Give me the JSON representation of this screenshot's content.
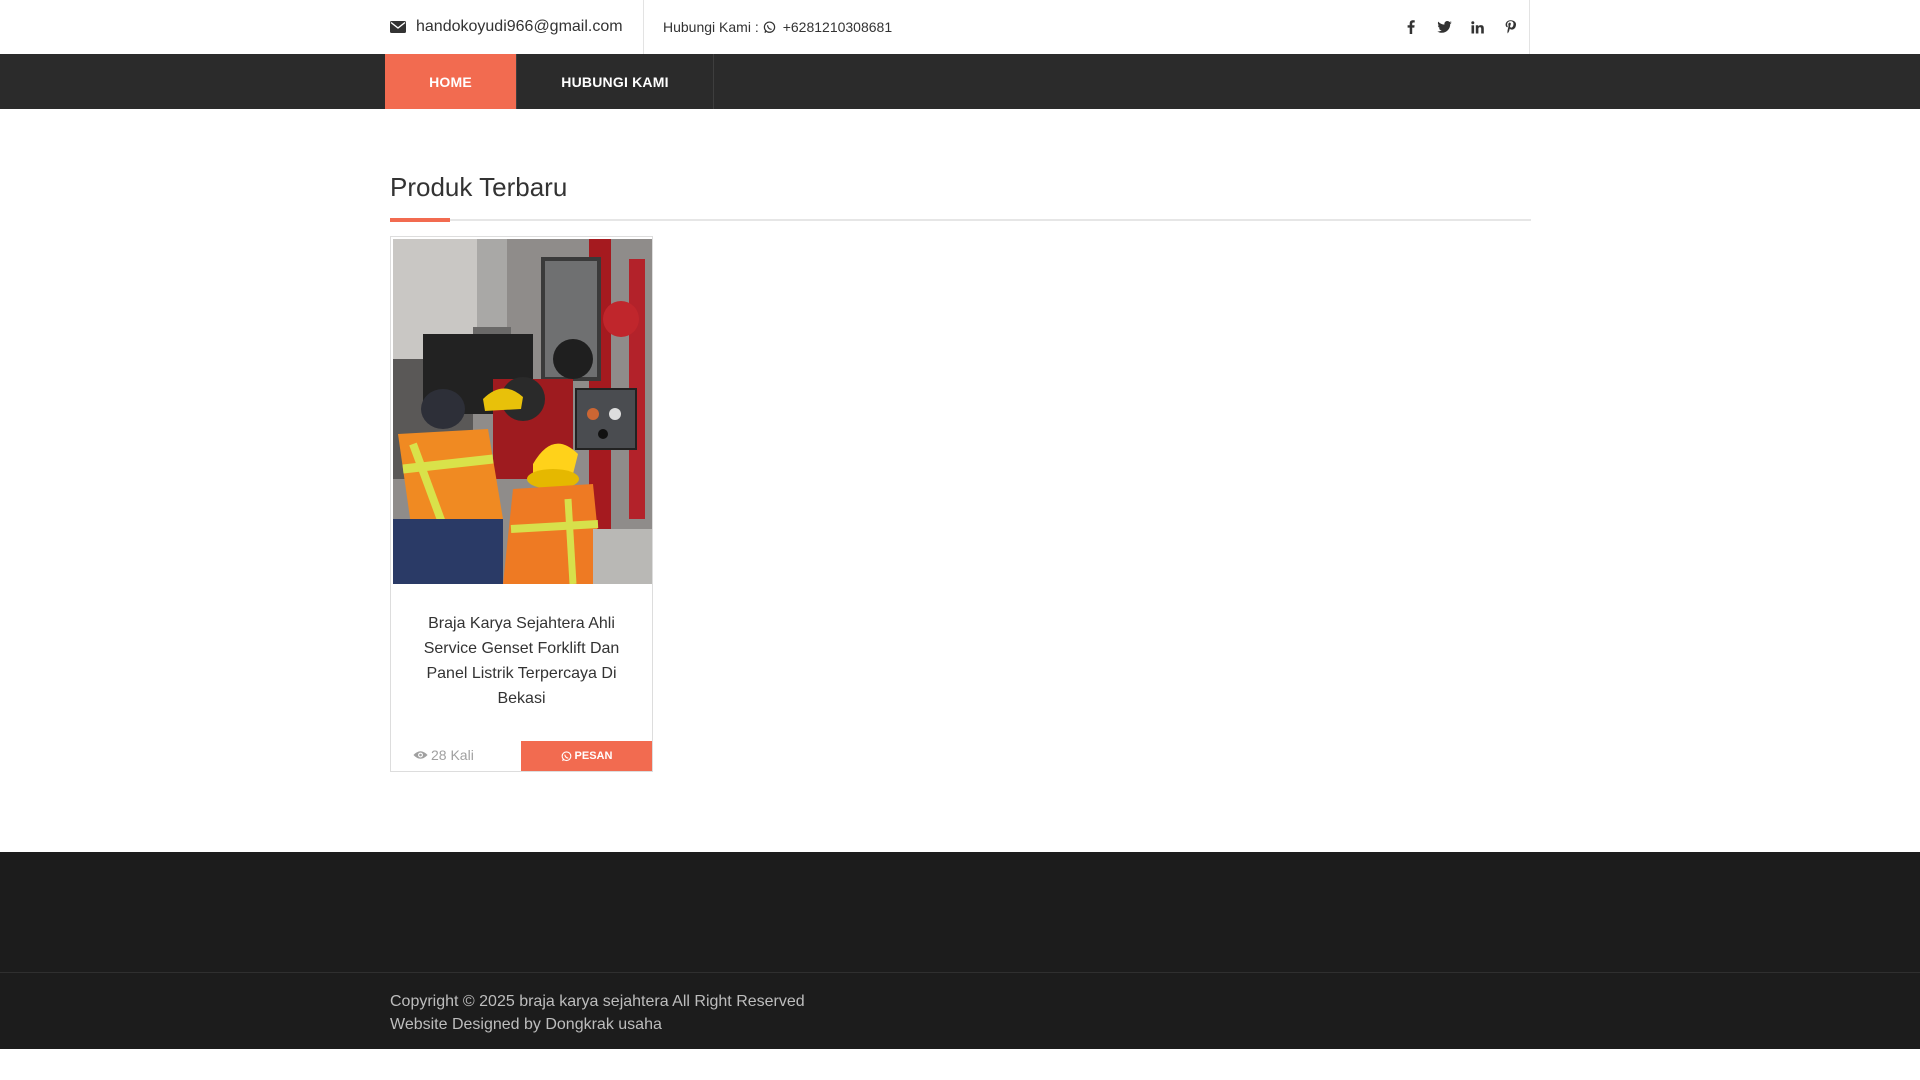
{
  "topbar": {
    "email": "handokoyudi966@gmail.com",
    "contact_label": "Hubungi Kami :",
    "phone": "+6281210308681",
    "social": [
      "facebook-icon",
      "twitter-icon",
      "linkedin-icon",
      "pinterest-icon"
    ]
  },
  "nav": {
    "items": [
      {
        "label": "HOME",
        "active": true
      },
      {
        "label": "HUBUNGI KAMI",
        "active": false
      }
    ]
  },
  "section": {
    "title": "Produk Terbaru"
  },
  "products": [
    {
      "title": "Braja Karya Sejahtera Ahli Service Genset Forklift Dan Panel Listrik Terpercaya Di Bekasi",
      "views": "28 Kali",
      "button": "PESAN"
    }
  ],
  "footer": {
    "copyright": "Copyright © 2025 braja karya sejahtera All Right Reserved",
    "designed_by": "Website Designed by Dongkrak usaha"
  },
  "colors": {
    "accent": "#f26b50",
    "nav_bg": "#2b2b2b",
    "footer_bg": "#1c1c1c"
  }
}
